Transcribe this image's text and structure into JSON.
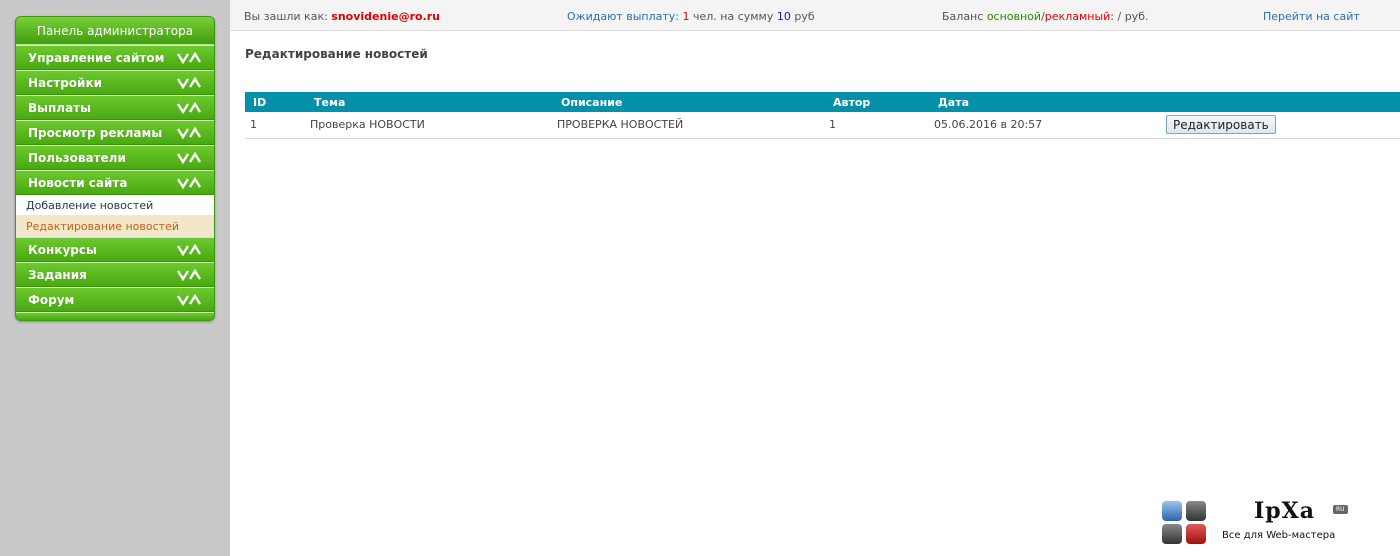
{
  "sidebar": {
    "title": "Панель администратора",
    "items": [
      {
        "label": "Управление сайтом"
      },
      {
        "label": "Настройки"
      },
      {
        "label": "Выплаты"
      },
      {
        "label": "Просмотр рекламы"
      },
      {
        "label": "Пользователи"
      },
      {
        "label": "Новости сайта"
      },
      {
        "label": "Конкурсы"
      },
      {
        "label": "Задания"
      },
      {
        "label": "Форум"
      }
    ],
    "news_submenu": [
      {
        "label": "Добавление новостей"
      },
      {
        "label": "Редактирование новостей"
      }
    ]
  },
  "topbar": {
    "login_prefix": "Вы зашли как:",
    "login_user": "snovidenie@ro.ru",
    "wait_label": "Ожидают выплату:",
    "wait_count": "1",
    "wait_mid": "чел. на сумму",
    "wait_sum": "10",
    "wait_currency": "руб",
    "balance_prefix": "Баланс",
    "balance_main": "основной",
    "balance_slash": "/",
    "balance_ad": "рекламный:",
    "balance_value": " / руб.",
    "site_link": "Перейти на сайт"
  },
  "main": {
    "title": "Редактирование новостей",
    "table": {
      "headers": {
        "id": "ID",
        "tema": "Тема",
        "opis": "Описание",
        "avtor": "Автор",
        "data": "Дата"
      },
      "rows": [
        {
          "id": "1",
          "tema": "Проверка НОВОСТИ",
          "opis": "ПРОВЕРКА НОВОСТЕЙ",
          "avtor": "1",
          "data": "05.06.2016 в 20:57",
          "action": "Редактировать"
        }
      ]
    }
  },
  "watermark": {
    "brand": "IpXa",
    "badge": "RU",
    "tagline": "Все для Web-мастера"
  },
  "colors": {
    "menu_green": "#56b81d",
    "table_header": "#0390a8",
    "accent_red": "#e00000",
    "link_blue": "#2a6fb0"
  }
}
